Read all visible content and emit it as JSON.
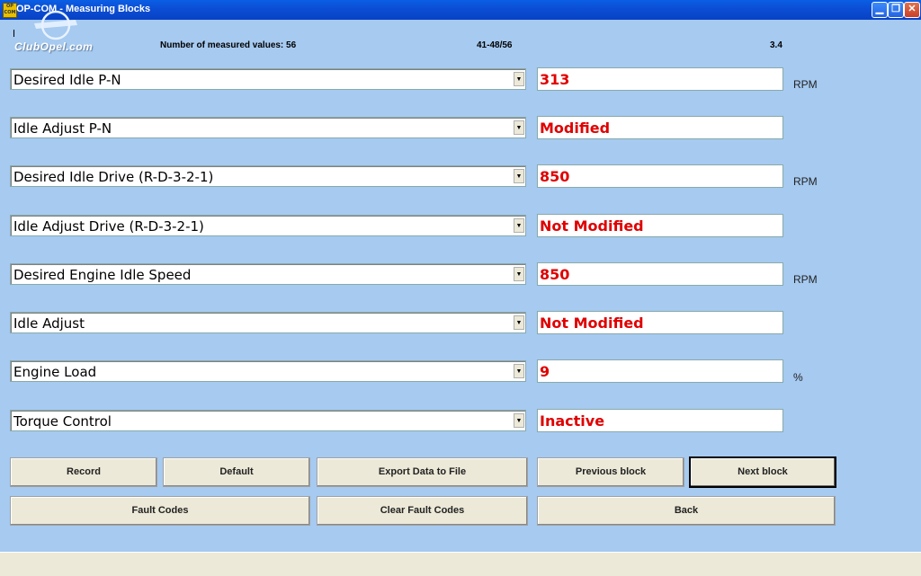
{
  "window": {
    "title": "OP-COM - Measuring Blocks",
    "app_icon_text": "OP COM"
  },
  "logo": {
    "text": "ClubOpel.com"
  },
  "info": {
    "measured_values": "Number of measured values: 56",
    "range": "41-48/56",
    "version": "3.4"
  },
  "rows": [
    {
      "label": "Desired Idle P-N",
      "value": "313",
      "unit": "RPM"
    },
    {
      "label": "Idle Adjust P-N",
      "value": "Modified",
      "unit": ""
    },
    {
      "label": "Desired Idle Drive (R-D-3-2-1)",
      "value": "850",
      "unit": "RPM"
    },
    {
      "label": "Idle Adjust Drive (R-D-3-2-1)",
      "value": "Not Modified",
      "unit": ""
    },
    {
      "label": "Desired Engine Idle Speed",
      "value": "850",
      "unit": "RPM"
    },
    {
      "label": "Idle Adjust",
      "value": "Not Modified",
      "unit": ""
    },
    {
      "label": "Engine Load",
      "value": "9",
      "unit": "%"
    },
    {
      "label": "Torque Control",
      "value": "Inactive",
      "unit": ""
    }
  ],
  "buttons": {
    "record": "Record",
    "default": "Default",
    "export": "Export Data to File",
    "previous": "Previous block",
    "next": "Next block",
    "fault_codes": "Fault Codes",
    "clear_fault_codes": "Clear Fault Codes",
    "back": "Back"
  },
  "colors": {
    "background": "#a6caf0",
    "value_text": "#e00000",
    "titlebar": "#0b4fd6"
  }
}
